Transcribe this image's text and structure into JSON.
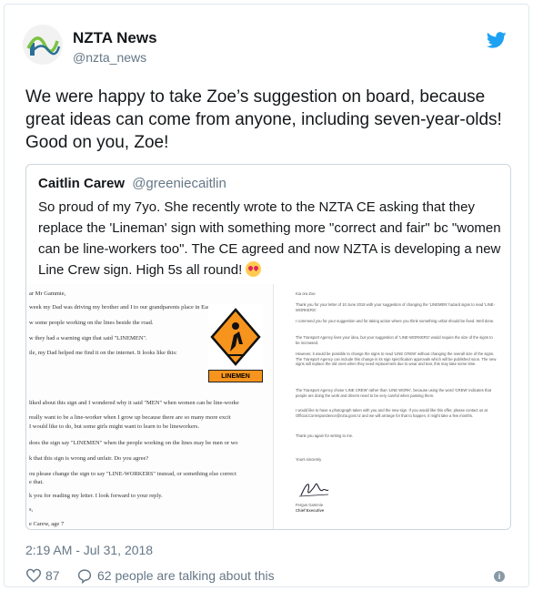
{
  "account": {
    "name": "NZTA News",
    "handle": "@nzta_news"
  },
  "tweet": {
    "text": "We were happy to take Zoe’s suggestion on board, because great ideas can come from anyone, including seven-year-olds! Good on you, Zoe!"
  },
  "quoted_tweet": {
    "name": "Caitlin Carew",
    "handle": "@greeniecaitlin",
    "text": "So proud of my 7yo. She recently wrote to the NZTA CE asking that they replace the 'Lineman' sign with something more \"correct and fair\" bc \"women can be line-workers too\". The CE agreed and now NZTA is developing a new Line Crew sign. High 5s all round!",
    "emoji": "heart-eyes-emoji"
  },
  "letter_left": {
    "lines": [
      "ar Mr Gammie,",
      "week my Dad was driving my brother and I to our grandparents place in Eastbourne.",
      "w some people working on the lines beside the road.",
      "w they had a warning sign that said \"LINEMEN\".",
      "ile, my Dad helped me find it on the internet. It looks like this:",
      "liked about this sign and I wondered why it said \"MEN\" when women can be line-worke",
      "really want to be a line-worker when I grow up because there are so many more excit",
      "I would like to do, but some girls might want to learn to be lineworkers.",
      "does the sign say \"LINEMEN\" when the people working on the lines may be men or wo",
      "k that this sign is wrong and unfair. Do you agree?",
      "ou please change the sign to say \"LINE-WORKERS\" instead, or something else correct",
      "e that.",
      "k you for reading my letter. I look forward to your reply.",
      "s,",
      "e Carew, age 7"
    ],
    "sign_label": "LINEMEN"
  },
  "letter_right": {
    "greeting": "Kia ora Zoe",
    "paragraphs": [
      "Thank you for your letter of 10 June 2018 with your suggestion of changing the 'LINEMEN' hazard signs to read 'LINE-WORKERS'.",
      "I commend you for your suggestion and for taking action where you think something unfair should be fixed. Well done.",
      "The Transport Agency lives your idea, but your suggestion of 'LINE-WORKERS' would require the size of the signs to be increased.",
      "However, it would be possible to change the signs to read 'LINE CREW' without changing the overall size of the signs. The Transport Agency can include this change in its sign specification approvals which will be published soon. The new signs will replace the old ones when they need replacement due to wear and tear, this may take some time.",
      "The Transport Agency chose 'LINE CREW' rather than 'LINE WORK', because using the word 'CREW' indicates that people are doing the work and drivers need to be very careful when passing them.",
      "I would like to have a photograph taken with you and the new sign. If you would like this offer, please contact us at Official.Correspondence@nzta.govt.nz and we will arrange for that to happen, it might take a few months.",
      "Thank you again for writing to me."
    ],
    "closing": "Yours sincerely",
    "signer_name": "Fergus Gammie",
    "signer_title": "Chief Executive"
  },
  "meta": {
    "timestamp": "2:19 AM - Jul 31, 2018",
    "like_count": "87",
    "talking": "62 people are talking about this"
  },
  "colors": {
    "twitter_blue": "#1da1f2",
    "sign_orange": "#f7941d",
    "secondary_text": "#657786"
  }
}
